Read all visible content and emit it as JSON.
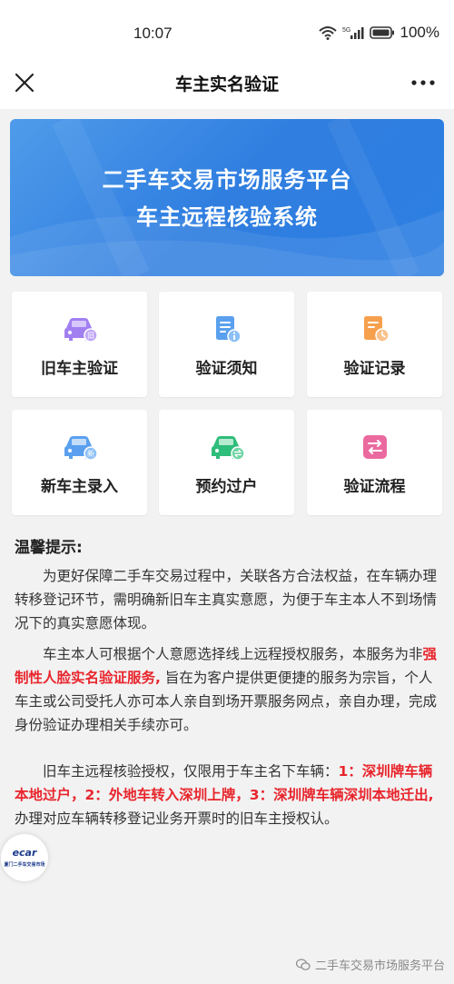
{
  "status_bar": {
    "time": "10:07",
    "battery": "100%",
    "network_label": "5G"
  },
  "nav": {
    "title": "车主实名验证",
    "close_icon": "close-icon",
    "more_icon": "more-icon"
  },
  "banner": {
    "line1": "二手车交易市场服务平台",
    "line2": "车主远程核验系统"
  },
  "tiles": [
    {
      "label": "旧车主验证",
      "icon": "old-car-icon",
      "badge": "旧",
      "color": "#a27ff1"
    },
    {
      "label": "验证须知",
      "icon": "notice-doc-icon",
      "color": "#5aa0ef"
    },
    {
      "label": "验证记录",
      "icon": "record-doc-icon",
      "color": "#f6a04d"
    },
    {
      "label": "新车主录入",
      "icon": "new-car-icon",
      "badge": "新",
      "color": "#5aa0ef"
    },
    {
      "label": "预约过户",
      "icon": "transfer-car-icon",
      "color": "#2ebd7a"
    },
    {
      "label": "验证流程",
      "icon": "flow-icon",
      "color": "#ea6aa0"
    }
  ],
  "notice": {
    "title": "温馨提示:",
    "p1": "为更好保障二手车交易过程中，关联各方合法权益，在车辆办理转移登记环节，需明确新旧车主真实意愿，为便于车主本人不到场情况下的真实意愿体现。",
    "p2_a": "车主本人可根据个人意愿选择线上远程授权服务，本服务为非",
    "p2_red": "强制性人脸实名验证服务,",
    "p2_b": " 旨在为客户提供更便捷的服务为宗旨，个人车主或公司受托人亦可本人亲自到场开票服务网点，亲自办理，完成身份验证办理相关手续亦可。",
    "p3_a": "旧车主远程核验授权，仅限用于车主名下车辆：",
    "p3_red": "1：深圳牌车辆本地过户，2：外地车转入深圳上牌，3：深圳牌车辆深圳本地迁出,",
    "p3_b": " 办理对应车辆转移登记业务开票时的旧车主授权认。"
  },
  "logo": {
    "text": "ecar",
    "sub": "厦门二手车交易市场"
  },
  "watermark": {
    "text": "二手车交易市场服务平台"
  },
  "colors": {
    "banner": "#2f7ee0",
    "highlight": "#e8252c"
  }
}
